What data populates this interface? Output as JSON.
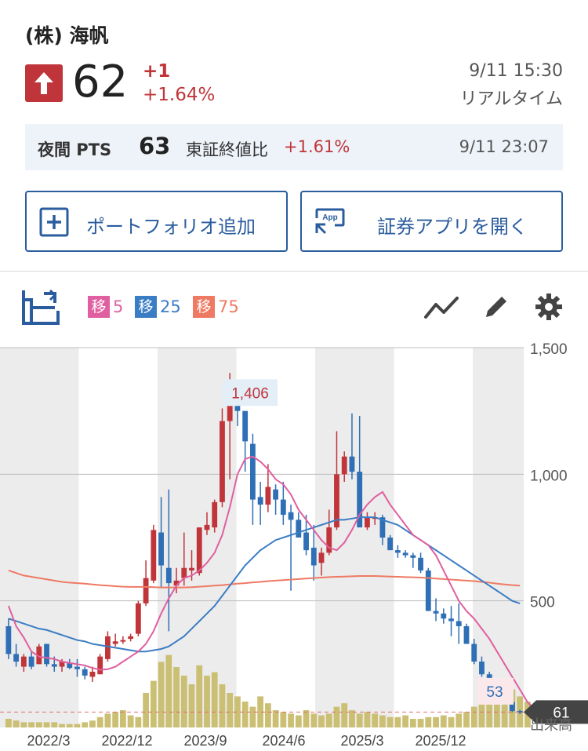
{
  "header": {
    "stock_name": "(株) 海帆",
    "price": "62",
    "change_abs": "+1",
    "change_pct": "+1.64%",
    "time": "9/11 15:30",
    "realtime_label": "リアルタイム",
    "up_color": "#c0353a"
  },
  "pts": {
    "label": "夜間 PTS",
    "price": "63",
    "compare_label": "東証終値比",
    "compare_pct": "+1.61%",
    "time": "9/11 23:07"
  },
  "buttons": {
    "portfolio_label": "ポートフォリオ追加",
    "portfolio_icon": "plus-square-icon",
    "app_label": "証券アプリを開く",
    "app_icon": "app-icon",
    "app_icon_text": "App"
  },
  "toolbar": {
    "ma_tag_text": "移",
    "ma": [
      {
        "value": "5",
        "color": "#e05fa0"
      },
      {
        "value": "25",
        "color": "#3b7dc4"
      },
      {
        "value": "75",
        "color": "#ee7a64"
      }
    ]
  },
  "chart_data": {
    "type": "candlestick",
    "y_axis_ticks": [
      "1,500",
      "1,000",
      "500"
    ],
    "x_axis_ticks": [
      "2022/3",
      "2022/12",
      "2023/9",
      "2024/6",
      "2025/3",
      "2025/12"
    ],
    "ylim": [
      0,
      1500
    ],
    "high_label": "1,406",
    "low_label": "53",
    "current_label": "61",
    "volume_label": "出来高",
    "colors": {
      "up": "#c0353a",
      "down": "#2f6fb5",
      "volume": "#cbbf74",
      "ma5": "#e05fa0",
      "ma25": "#3b7dc4",
      "ma75": "#ee7a64"
    },
    "candles": [
      {
        "o": 400,
        "h": 430,
        "l": 270,
        "c": 290
      },
      {
        "o": 290,
        "h": 330,
        "l": 240,
        "c": 260
      },
      {
        "o": 240,
        "h": 290,
        "l": 220,
        "c": 280
      },
      {
        "o": 280,
        "h": 300,
        "l": 230,
        "c": 240
      },
      {
        "o": 250,
        "h": 330,
        "l": 250,
        "c": 320
      },
      {
        "o": 330,
        "h": 330,
        "l": 240,
        "c": 250
      },
      {
        "o": 250,
        "h": 280,
        "l": 220,
        "c": 240
      },
      {
        "o": 240,
        "h": 270,
        "l": 220,
        "c": 260
      },
      {
        "o": 255,
        "h": 270,
        "l": 230,
        "c": 235
      },
      {
        "o": 240,
        "h": 270,
        "l": 200,
        "c": 230
      },
      {
        "o": 230,
        "h": 240,
        "l": 190,
        "c": 205
      },
      {
        "o": 200,
        "h": 240,
        "l": 180,
        "c": 220
      },
      {
        "o": 210,
        "h": 290,
        "l": 210,
        "c": 280
      },
      {
        "o": 270,
        "h": 380,
        "l": 260,
        "c": 360
      },
      {
        "o": 330,
        "h": 370,
        "l": 320,
        "c": 340
      },
      {
        "o": 340,
        "h": 360,
        "l": 330,
        "c": 345
      },
      {
        "o": 350,
        "h": 370,
        "l": 340,
        "c": 360
      },
      {
        "o": 370,
        "h": 500,
        "l": 360,
        "c": 490
      },
      {
        "o": 490,
        "h": 660,
        "l": 480,
        "c": 590
      },
      {
        "o": 580,
        "h": 800,
        "l": 570,
        "c": 780
      },
      {
        "o": 770,
        "h": 910,
        "l": 550,
        "c": 640
      },
      {
        "o": 630,
        "h": 940,
        "l": 380,
        "c": 570
      },
      {
        "o": 560,
        "h": 630,
        "l": 530,
        "c": 580
      },
      {
        "o": 590,
        "h": 770,
        "l": 560,
        "c": 630
      },
      {
        "o": 620,
        "h": 700,
        "l": 580,
        "c": 630
      },
      {
        "o": 610,
        "h": 790,
        "l": 600,
        "c": 790
      },
      {
        "o": 780,
        "h": 850,
        "l": 760,
        "c": 800
      },
      {
        "o": 790,
        "h": 900,
        "l": 770,
        "c": 890
      },
      {
        "o": 890,
        "h": 1260,
        "l": 870,
        "c": 1210
      },
      {
        "o": 1210,
        "h": 1400,
        "l": 980,
        "c": 1300
      },
      {
        "o": 1300,
        "h": 1320,
        "l": 1190,
        "c": 1250
      },
      {
        "o": 1250,
        "h": 1220,
        "l": 1010,
        "c": 1130
      },
      {
        "o": 1120,
        "h": 1160,
        "l": 800,
        "c": 900
      },
      {
        "o": 910,
        "h": 970,
        "l": 800,
        "c": 880
      },
      {
        "o": 880,
        "h": 1040,
        "l": 850,
        "c": 950
      },
      {
        "o": 940,
        "h": 960,
        "l": 840,
        "c": 900
      },
      {
        "o": 900,
        "h": 970,
        "l": 800,
        "c": 840
      },
      {
        "o": 850,
        "h": 880,
        "l": 540,
        "c": 820
      },
      {
        "o": 820,
        "h": 850,
        "l": 770,
        "c": 750
      },
      {
        "o": 770,
        "h": 840,
        "l": 680,
        "c": 700
      },
      {
        "o": 710,
        "h": 800,
        "l": 580,
        "c": 640
      },
      {
        "o": 650,
        "h": 710,
        "l": 600,
        "c": 690
      },
      {
        "o": 690,
        "h": 860,
        "l": 680,
        "c": 790
      },
      {
        "o": 790,
        "h": 1170,
        "l": 780,
        "c": 1000
      },
      {
        "o": 1000,
        "h": 1090,
        "l": 970,
        "c": 1070
      },
      {
        "o": 1070,
        "h": 1240,
        "l": 980,
        "c": 1010
      },
      {
        "o": 1010,
        "h": 1230,
        "l": 830,
        "c": 790
      },
      {
        "o": 790,
        "h": 850,
        "l": 780,
        "c": 830
      },
      {
        "o": 830,
        "h": 850,
        "l": 800,
        "c": 830
      },
      {
        "o": 830,
        "h": 840,
        "l": 720,
        "c": 750
      },
      {
        "o": 750,
        "h": 760,
        "l": 700,
        "c": 700
      },
      {
        "o": 700,
        "h": 720,
        "l": 670,
        "c": 690
      },
      {
        "o": 690,
        "h": 700,
        "l": 670,
        "c": 680
      },
      {
        "o": 680,
        "h": 690,
        "l": 630,
        "c": 670
      },
      {
        "o": 670,
        "h": 690,
        "l": 610,
        "c": 620
      },
      {
        "o": 620,
        "h": 630,
        "l": 460,
        "c": 460
      },
      {
        "o": 460,
        "h": 510,
        "l": 420,
        "c": 450
      },
      {
        "o": 450,
        "h": 470,
        "l": 410,
        "c": 430
      },
      {
        "o": 430,
        "h": 480,
        "l": 360,
        "c": 420
      },
      {
        "o": 420,
        "h": 490,
        "l": 330,
        "c": 400
      },
      {
        "o": 400,
        "h": 410,
        "l": 330,
        "c": 330
      },
      {
        "o": 330,
        "h": 350,
        "l": 250,
        "c": 260
      },
      {
        "o": 260,
        "h": 280,
        "l": 200,
        "c": 210
      },
      {
        "o": 210,
        "h": 220,
        "l": 160,
        "c": 170
      },
      {
        "o": 170,
        "h": 180,
        "l": 120,
        "c": 130
      },
      {
        "o": 130,
        "h": 140,
        "l": 90,
        "c": 100
      },
      {
        "o": 100,
        "h": 110,
        "l": 60,
        "c": 65
      },
      {
        "o": 65,
        "h": 70,
        "l": 53,
        "c": 61
      }
    ],
    "volume": [
      5,
      4,
      3,
      3,
      3,
      3,
      3,
      2,
      2,
      2,
      3,
      4,
      6,
      8,
      9,
      10,
      7,
      6,
      20,
      27,
      38,
      42,
      35,
      30,
      25,
      36,
      30,
      32,
      25,
      20,
      18,
      15,
      12,
      18,
      14,
      10,
      9,
      8,
      7,
      10,
      8,
      7,
      8,
      12,
      14,
      10,
      8,
      9,
      8,
      7,
      6,
      6,
      7,
      5,
      5,
      6,
      6,
      7,
      6,
      8,
      9,
      12,
      14,
      18,
      20,
      24,
      22,
      18,
      15
    ],
    "ma5": [
      480,
      400,
      355,
      300,
      280,
      275,
      270,
      260,
      255,
      250,
      245,
      235,
      228,
      230,
      240,
      260,
      280,
      300,
      330,
      380,
      450,
      510,
      560,
      590,
      600,
      620,
      650,
      690,
      760,
      870,
      1000,
      1060,
      1070,
      1050,
      1020,
      980,
      960,
      920,
      860,
      820,
      780,
      740,
      710,
      700,
      730,
      780,
      840,
      880,
      910,
      930,
      880,
      840,
      800,
      760,
      740,
      720,
      680,
      620,
      560,
      500,
      460,
      430,
      390,
      350,
      300,
      250,
      200,
      150,
      100,
      70
    ],
    "ma25": [
      430,
      420,
      410,
      400,
      390,
      385,
      375,
      365,
      355,
      345,
      340,
      330,
      325,
      320,
      315,
      310,
      305,
      300,
      300,
      305,
      310,
      320,
      340,
      360,
      390,
      420,
      450,
      480,
      520,
      560,
      600,
      640,
      670,
      700,
      720,
      740,
      750,
      760,
      770,
      780,
      790,
      800,
      810,
      820,
      820,
      825,
      830,
      830,
      830,
      820,
      810,
      800,
      780,
      760,
      740,
      720,
      700,
      680,
      660,
      640,
      620,
      600,
      580,
      560,
      540,
      520,
      500,
      490
    ],
    "ma75": [
      620,
      610,
      600,
      595,
      590,
      585,
      580,
      575,
      572,
      570,
      568,
      565,
      562,
      560,
      558,
      556,
      555,
      555,
      555,
      554,
      553,
      553,
      553,
      553,
      554,
      556,
      558,
      560,
      562,
      565,
      568,
      570,
      573,
      575,
      578,
      580,
      582,
      584,
      586,
      588,
      590,
      592,
      594,
      595,
      596,
      597,
      598,
      598,
      598,
      597,
      596,
      595,
      594,
      593,
      592,
      590,
      588,
      586,
      584,
      582,
      580,
      578,
      575,
      572,
      568,
      565,
      562,
      560
    ]
  }
}
